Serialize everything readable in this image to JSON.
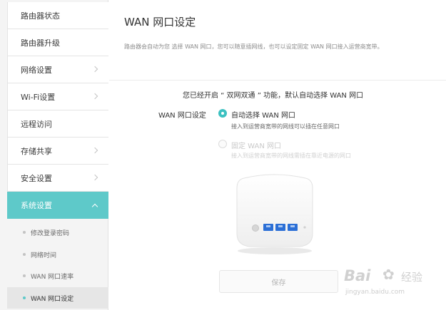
{
  "sidebar": {
    "items": [
      {
        "label": "路由器状态"
      },
      {
        "label": "路由器升级"
      },
      {
        "label": "网络设置"
      },
      {
        "label": "Wi-Fi设置"
      },
      {
        "label": "远程访问"
      },
      {
        "label": "存储共享"
      },
      {
        "label": "安全设置"
      },
      {
        "label": "系统设置"
      }
    ],
    "active_item": "系统设置",
    "sub_items": [
      {
        "label": "修改登录密码"
      },
      {
        "label": "网络时间"
      },
      {
        "label": "WAN 网口速率"
      },
      {
        "label": "WAN 网口设定"
      }
    ],
    "current_sub_item": "WAN 网口设定"
  },
  "main": {
    "title": "WAN 网口设定",
    "description": "路由器会自动为您 选择 WAN 网口，您可以随意插网线，也可以设定固定 WAN 网口接入运营商宽带。",
    "notice": "您已经开启 “ 双网双通 ” 功能，默认自动选择 WAN 网口",
    "field_label": "WAN 网口设定",
    "options": [
      {
        "label": "自动选择 WAN 网口",
        "hint": "接入到运营商宽带的网线可以插在任意网口",
        "selected": true,
        "enabled": true
      },
      {
        "label": "固定 WAN 网口",
        "hint": "接入到运营商宽带的网线需插在靠近电源的网口",
        "selected": false,
        "enabled": false
      }
    ],
    "save_label": "保存"
  },
  "watermark": {
    "brand": "Bai",
    "brand_suffix": "经验",
    "url": "jingyan.baidu.com"
  },
  "colors": {
    "accent": "#5ec9c9",
    "radio_accent": "#3cc1c1",
    "router_port": "#2b6fd6"
  }
}
